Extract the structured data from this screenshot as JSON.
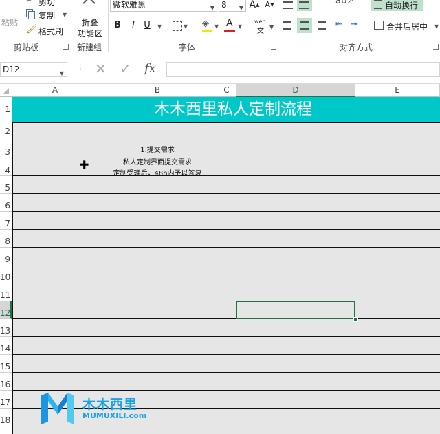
{
  "ribbon": {
    "clipboard": {
      "cut": "剪切",
      "copy": "复制",
      "format_painter": "格式刷",
      "paste": "粘贴",
      "group": "剪贴板"
    },
    "new_group": {
      "collapse_line1": "折叠",
      "collapse_line2": "功能区",
      "group": "新建组"
    },
    "font": {
      "font_name": "微软雅黑",
      "font_size": "8",
      "grow_label": "A",
      "shrink_label": "A",
      "bold": "B",
      "italic": "I",
      "underline": "U",
      "font_color_label": "A",
      "phonetic_top": "wén",
      "phonetic_bottom": "文",
      "group": "字体"
    },
    "alignment": {
      "wrap_text": "自动换行",
      "merge_center": "合并后居中",
      "group": "对齐方式"
    }
  },
  "formula_bar": {
    "name_box": "D12",
    "fx": "fx",
    "content": ""
  },
  "columns": [
    "A",
    "B",
    "C",
    "D",
    "E"
  ],
  "rows": [
    "1",
    "2",
    "3",
    "4",
    "5",
    "6",
    "7",
    "8",
    "9",
    "10",
    "11",
    "12",
    "13",
    "14",
    "15",
    "16",
    "17",
    "18"
  ],
  "sheet": {
    "title": "木木西里私人定制流程",
    "step1_title": "1.提交需求",
    "step1_line1": "私人定制界面提交需求",
    "step1_line2": "定制受理后，48h内予以答复"
  },
  "watermark": {
    "name": "木木西里",
    "url": "MUMUXILI.com"
  },
  "colors": {
    "title_bg": "#00c8c8",
    "cell_bg": "#e6e6e6",
    "selection": "#217346",
    "highlight_button": "#bfe0cd"
  }
}
